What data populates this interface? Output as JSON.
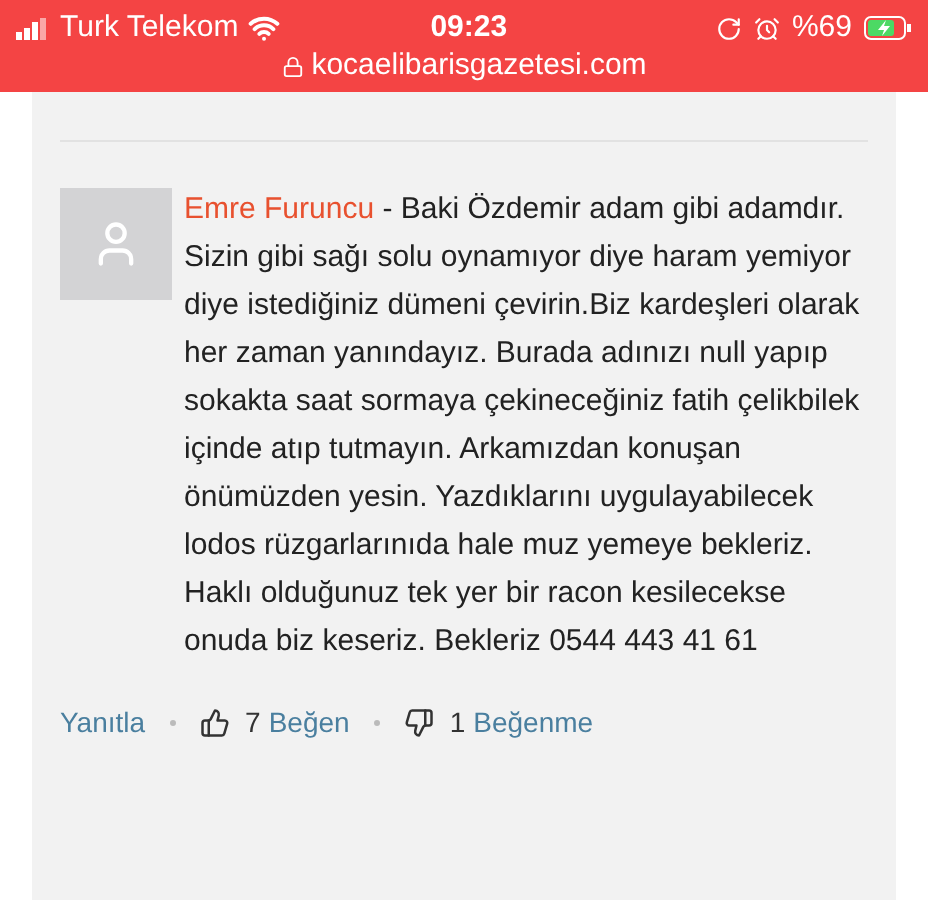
{
  "status_bar": {
    "carrier": "Turk Telekom",
    "time": "09:23",
    "battery": "%69",
    "url": "kocaelibarisgazetesi.com"
  },
  "comment": {
    "author": "Emre Furuncu",
    "separator": " - ",
    "text": "Baki Özdemir adam gibi adamdır. Sizin gibi sağı solu oynamıyor diye haram yemiyor diye istediğiniz dümeni çevirin.Biz kardeşleri olarak her zaman yanındayız. Burada adınızı null yapıp sokakta saat sormaya çekineceğiniz fatih çelikbilek içinde atıp tutmayın. Arkamızdan konuşan önümüzden yesin. Yazdıklarını uygulayabilecek lodos rüzgarlarınıda hale muz yemeye bekleriz. Haklı olduğunuz tek yer bir racon kesilecekse onuda biz keseriz. Bekleriz 0544 443 41 61"
  },
  "actions": {
    "reply": "Yanıtla",
    "likes": "7",
    "like": "Beğen",
    "dislikes": "1",
    "dislike": "Beğenme"
  }
}
